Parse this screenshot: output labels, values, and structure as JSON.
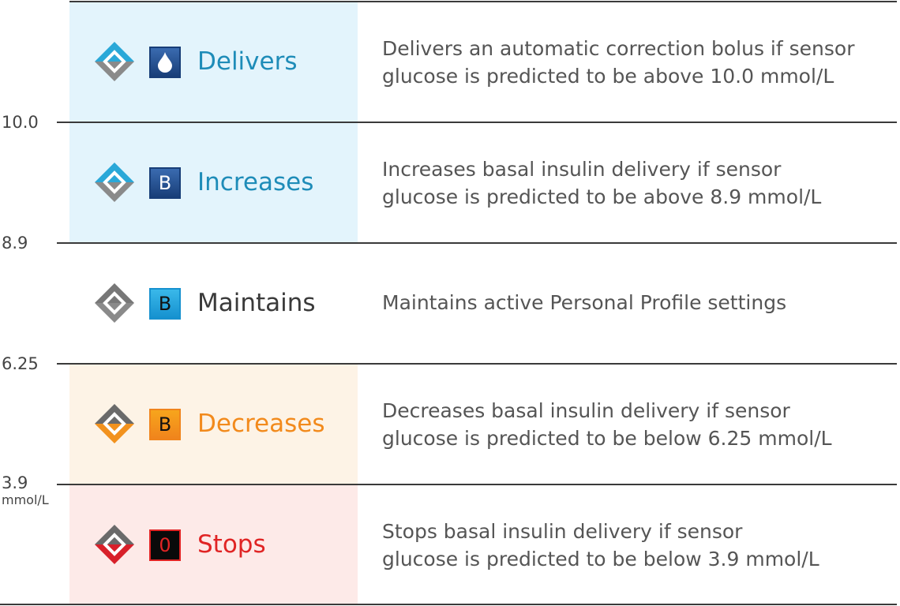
{
  "unit": "mmol/L",
  "thresholds": [
    "10.0",
    "8.9",
    "6.25",
    "3.9"
  ],
  "rows": [
    {
      "label": "Delivers",
      "icon": "drop-icon",
      "icon_text": "",
      "desc": [
        "Delivers an automatic correction bolus if sensor",
        "glucose is predicted to be above 10.0 mmol/L"
      ],
      "label_color": "#1e8cb8",
      "band": "#e3f4fc",
      "top": "#2aa8d8",
      "bottom": "#8a8a8a",
      "sq_bg": "linear-gradient(#3a6bb0,#183e78)",
      "sq_border": "#183e78",
      "sq_color": "#fff"
    },
    {
      "label": "Increases",
      "icon": "basal-b-icon",
      "icon_text": "B",
      "desc": [
        "Increases basal insulin delivery if sensor",
        "glucose is predicted to be above 8.9 mmol/L"
      ],
      "label_color": "#1e8cb8",
      "band": "#e3f4fc",
      "top": "#2aa8d8",
      "bottom": "#8a8a8a",
      "sq_bg": "linear-gradient(#3a6bb0,#183e78)",
      "sq_border": "#183e78",
      "sq_color": "#fff"
    },
    {
      "label": "Maintains",
      "icon": "basal-b-icon",
      "icon_text": "B",
      "desc": [
        "Maintains active Personal Profile settings"
      ],
      "label_color": "#3a3a3a",
      "band": "transparent",
      "top": "#777",
      "bottom": "#8a8a8a",
      "sq_bg": "linear-gradient(#3ab8ea,#1691cf)",
      "sq_border": "#1691cf",
      "sq_color": "#111"
    },
    {
      "label": "Decreases",
      "icon": "basal-b-icon",
      "icon_text": "B",
      "desc": [
        "Decreases basal insulin delivery if sensor",
        "glucose is predicted to be below 6.25 mmol/L"
      ],
      "label_color": "#f28a1c",
      "band": "#fdf3e6",
      "top": "#6a6a6a",
      "bottom": "#f2921e",
      "sq_bg": "linear-gradient(#f7a51c,#f0841c)",
      "sq_border": "#f0841c",
      "sq_color": "#111"
    },
    {
      "label": "Stops",
      "icon": "zero-icon",
      "icon_text": "0",
      "desc": [
        "Stops basal insulin delivery if sensor",
        "glucose is predicted to be below 3.9 mmol/L"
      ],
      "label_color": "#e02424",
      "band": "#fdeae8",
      "top": "#6a6a6a",
      "bottom": "#d8202a",
      "sq_bg": "#0a0a0a",
      "sq_border": "#e02424",
      "sq_color": "#e02424"
    }
  ]
}
